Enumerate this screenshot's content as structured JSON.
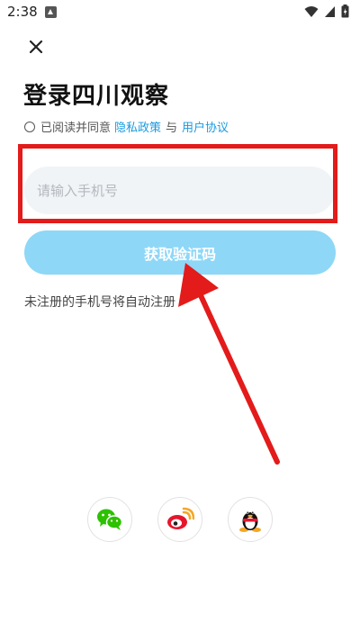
{
  "status": {
    "time": "2:38"
  },
  "page": {
    "title": "登录四川观察",
    "agree_prefix": "已阅读并同意",
    "privacy_link": "隐私政策",
    "and_text": "与",
    "user_agreement_link": "用户协议",
    "phone_placeholder": "请输入手机号",
    "get_code_button": "获取验证码",
    "hint": "未注册的手机号将自动注册"
  },
  "social_login": [
    "wechat-icon",
    "weibo-icon",
    "qq-icon"
  ],
  "colors": {
    "button_bg": "#8ed7f7",
    "link": "#1a9be0",
    "annotation_red": "#e31b1b",
    "input_bg": "#f1f4f7"
  }
}
